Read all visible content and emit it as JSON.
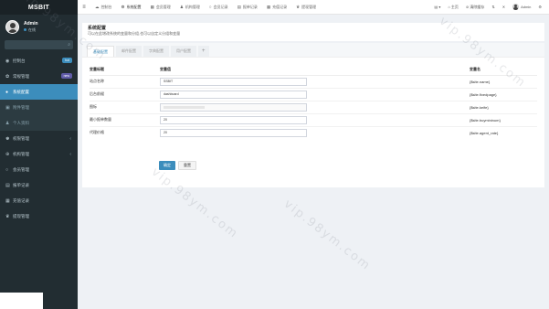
{
  "sidebar": {
    "brand": "MSBIT",
    "user": {
      "name": "Admin",
      "status": "在线"
    },
    "items": [
      {
        "label": "控制台",
        "icon": "dashboard-icon",
        "badge": "hot",
        "badge_color": "#3c8dbc"
      },
      {
        "label": "常规管理",
        "icon": "cogs-icon",
        "badge": "new",
        "badge_color": "#605ca8"
      },
      {
        "label": "系统配置",
        "icon": "cog-icon",
        "active": true
      },
      {
        "label": "附件管理",
        "icon": "file-icon",
        "sub": true
      },
      {
        "label": "个人资料",
        "icon": "user-icon",
        "sub": true
      },
      {
        "label": "权限管理",
        "icon": "group-icon",
        "chevron": "‹"
      },
      {
        "label": "机构管理",
        "icon": "circle-icon",
        "chevron": "‹"
      },
      {
        "label": "会员管理",
        "icon": "circle-o-icon"
      },
      {
        "label": "报单记录",
        "icon": "list-icon"
      },
      {
        "label": "充值记录",
        "icon": "money-icon"
      },
      {
        "label": "提现管理",
        "icon": "users-icon"
      }
    ]
  },
  "topnav": {
    "toggle": "≡",
    "tabs": [
      {
        "label": "控制台",
        "icon": "☁"
      },
      {
        "label": "系统配置",
        "icon": "⚙",
        "active": true
      },
      {
        "label": "会员管理",
        "icon": "▦"
      },
      {
        "label": "机构管理",
        "icon": "♟"
      },
      {
        "label": "会员记录",
        "icon": "○"
      },
      {
        "label": "报单记录",
        "icon": "▤"
      },
      {
        "label": "充值记录",
        "icon": "▦"
      },
      {
        "label": "提现管理",
        "icon": "♛"
      }
    ],
    "right": [
      {
        "label": "▤ ▾"
      },
      {
        "label": "⌂ 主页"
      },
      {
        "label": "⊘ 清除缓存"
      },
      {
        "label": "⇅"
      },
      {
        "label": "✕"
      }
    ],
    "admin": "Admin",
    "settings_icon": "⚙"
  },
  "content": {
    "title": "系统配置",
    "desc": "可以在此增改系统的变量和分组,也可以自定义分组和变量"
  },
  "tabs": [
    "基础配置",
    "邮件配置",
    "字典配置",
    "用户配置",
    "+"
  ],
  "table": {
    "headers": [
      "变量标题",
      "变量值",
      "变量名"
    ],
    "rows": [
      {
        "title": "站点名称",
        "value": "SSBIT",
        "var": "{$site.name}"
      },
      {
        "title": "后台前缀",
        "value": "dashboard",
        "var": "{$site.fixedpage}"
      },
      {
        "title": "图标",
        "value": "",
        "var": "{$site.keife}"
      },
      {
        "title": "最小报单数量",
        "value": "20",
        "var": "{$site.buymininum}"
      },
      {
        "title": "代理价格",
        "value": "20",
        "var": "{$site.agent_rate}"
      }
    ]
  },
  "buttons": {
    "confirm": "确定",
    "reset": "重置"
  },
  "watermark": "vip.98ym.com"
}
